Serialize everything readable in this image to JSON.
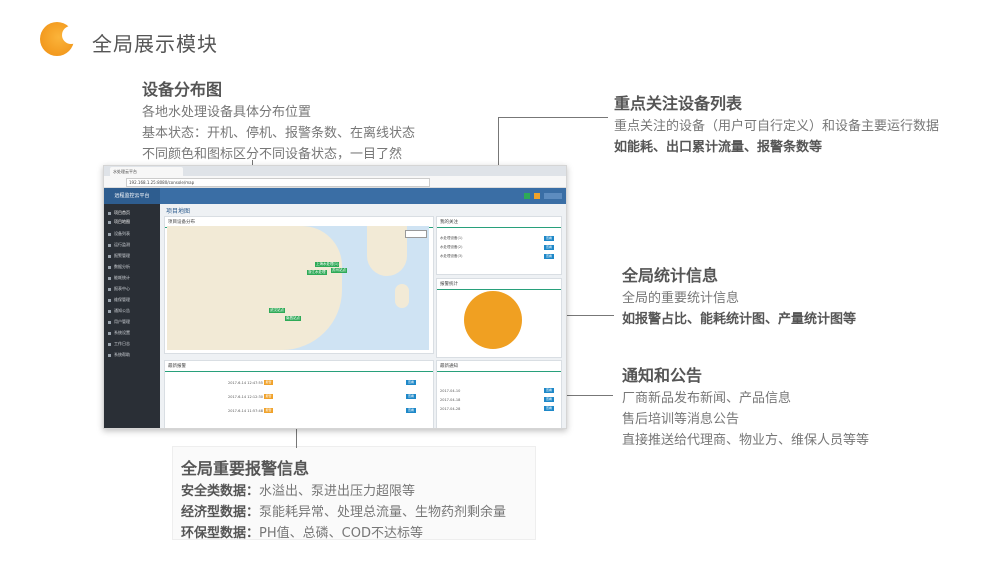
{
  "header": {
    "title": "全局展示模块"
  },
  "annotations": {
    "device_map": {
      "title": "设备分布图",
      "lines": [
        "各地水处理设备具体分布位置",
        "基本状态：开机、停机、报警条数、在离线状态",
        "不同颜色和图标区分不同设备状态，一目了然"
      ]
    },
    "key_devices": {
      "title": "重点关注设备列表",
      "line": "重点关注的设备（用户可自行定义）和设备主要运行数据",
      "bold_line": "如能耗、出口累计流量、报警条数等"
    },
    "global_stats": {
      "title": "全局统计信息",
      "line": "全局的重要统计信息",
      "bold_line": "如报警占比、能耗统计图、产量统计图等"
    },
    "notices": {
      "title": "通知和公告",
      "lines": [
        "厂商新品发布新闻、产品信息",
        "售后培训等消息公告",
        "直接推送给代理商、物业方、维保人员等等"
      ]
    },
    "alarms": {
      "title": "全局重要报警信息",
      "rows": [
        {
          "label": "安全类数据：",
          "text": "水溢出、泵进出压力超限等"
        },
        {
          "label": "经济型数据：",
          "text": "泵能耗异常、处理总流量、生物药剂剩余量"
        },
        {
          "label": "环保型数据：",
          "text": "PH值、总磷、COD不达标等"
        }
      ]
    }
  },
  "screenshot": {
    "tab": "水处理云平台",
    "url": "192.168.1.25:8080/console/map",
    "brand": "远程监控云平台",
    "page_title": "项目地图",
    "sidebar": [
      "项目首页",
      "项目地图",
      "设备列表",
      "运行监测",
      "报警管理",
      "数据分析",
      "能耗统计",
      "报表中心",
      "维保管理",
      "通知公告",
      "用户管理",
      "系统设置",
      "工作日志",
      "系统帮助"
    ],
    "panels": {
      "map": "项目设备分布",
      "focus": "我的关注",
      "stats": "报警统计",
      "alarms": "最新报警",
      "notices": "最新通知"
    },
    "map_markers": [
      "上海水处理(1)",
      "浙江水处理",
      "苏州站点",
      "武汉站点",
      "南昌站点"
    ],
    "focus_rows": [
      "水处理设备(1)",
      "水处理设备(2)",
      "水处理设备(3)"
    ],
    "alarm_rows": [
      "2017-6-14 12:47:55",
      "2017-6-14 12:12:30",
      "2017-6-14 11:57:48"
    ],
    "notice_rows": [
      "2017-04-10",
      "2017-04-18",
      "2017-04-28"
    ],
    "action": "查看",
    "level": "报警"
  },
  "colors": {
    "accent": "#ef8e12",
    "line": "#777777",
    "app_blue": "#3a6ea5",
    "pie": "#f0a022"
  }
}
